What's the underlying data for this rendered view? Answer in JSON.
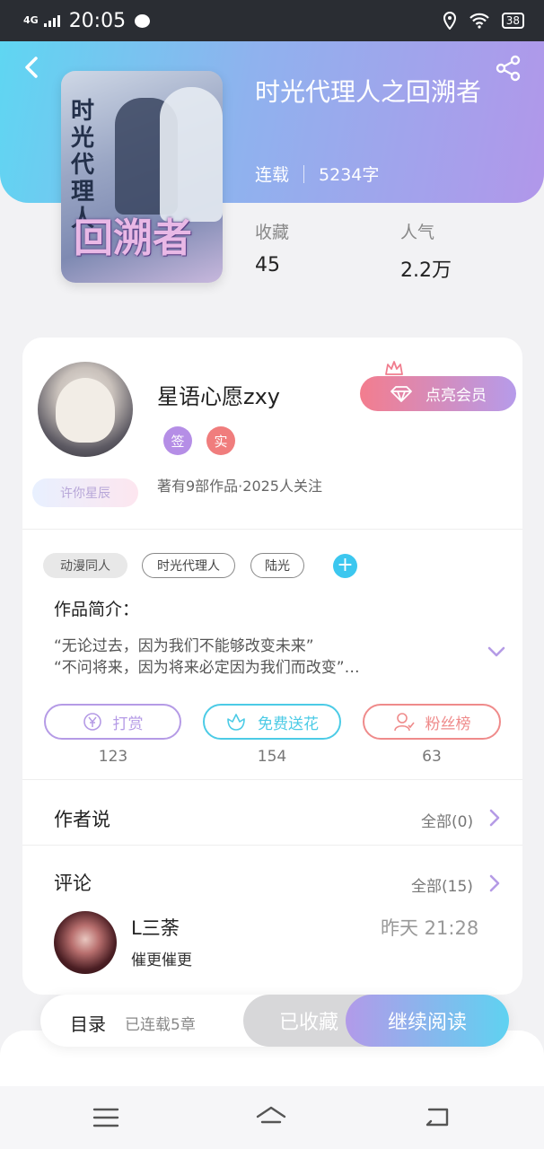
{
  "status_bar": {
    "network": "4G",
    "time": "20:05",
    "battery": "38"
  },
  "book": {
    "title": "时光代理人之回溯者",
    "status": "连载",
    "word_count": "5234字",
    "cover": {
      "vertical_title": "时光代理人",
      "big_title": "回溯者"
    },
    "stats": [
      {
        "label": "收藏",
        "value": "45"
      },
      {
        "label": "人气",
        "value": "2.2万"
      }
    ]
  },
  "author": {
    "name": "星语心愿zxy",
    "badges": [
      {
        "label": "签",
        "color": "#b58ee6"
      },
      {
        "label": "实",
        "color": "#f07d7d"
      }
    ],
    "frame_tag": "许你星辰",
    "summary": "著有9部作品·2025人关注",
    "vip_label": "点亮会员"
  },
  "tags": [
    {
      "label": "动漫同人",
      "style": "filled"
    },
    {
      "label": "时光代理人",
      "style": "outline"
    },
    {
      "label": "陆光",
      "style": "outline"
    }
  ],
  "intro": {
    "title": "作品简介：",
    "lines": [
      "“无论过去，因为我们不能够改变未来”",
      "“不问将来，因为将来必定因为我们而改变”…"
    ]
  },
  "actions": [
    {
      "label": "打赏",
      "count": "123",
      "color": "#b59be6",
      "icon": "yen-coin-icon"
    },
    {
      "label": "免费送花",
      "count": "154",
      "color": "#4ccbe6",
      "icon": "flower-icon"
    },
    {
      "label": "粉丝榜",
      "count": "63",
      "color": "#ef8b8b",
      "icon": "fans-user-icon"
    }
  ],
  "author_says": {
    "title": "作者说",
    "more": "全部(0)"
  },
  "comments": {
    "title": "评论",
    "more": "全部(15)",
    "items": [
      {
        "user": "L三荼",
        "text": "催更催更",
        "time": "昨天 21:28"
      }
    ]
  },
  "bottom_bar": {
    "toc": "目录",
    "chapters": "已连载5章",
    "favorite": "已收藏",
    "read": "继续阅读"
  },
  "colors": {
    "accent_purple": "#b59be6",
    "accent_cyan": "#5fd2f1",
    "accent_pink": "#f37d8e"
  }
}
